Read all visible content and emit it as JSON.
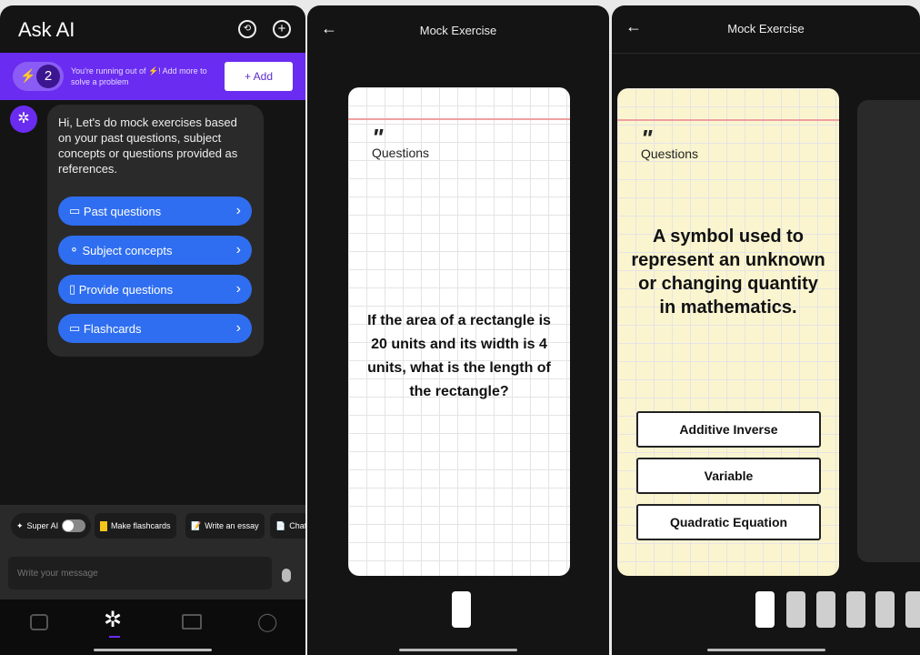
{
  "chat": {
    "title": "Ask AI",
    "icons": [
      "history-icon",
      "new-chat-icon"
    ],
    "banner": {
      "count": "2",
      "message": "You're running out of ⚡! Add more to solve a problem",
      "add_label": "+ Add",
      "color": "#6a2cf0"
    },
    "bot_message": "Hi, Let's do mock exercises based on your past questions, subject concepts or questions provided as references.",
    "options": [
      {
        "label": "Past questions",
        "icon": "inbox-icon"
      },
      {
        "label": "Subject concepts",
        "icon": "concepts-icon"
      },
      {
        "label": "Provide questions",
        "icon": "book-icon"
      },
      {
        "label": "Flashcards",
        "icon": "cards-icon"
      }
    ],
    "chips": {
      "super_ai": "Super AI",
      "make_flashcards": "Make flashcards",
      "write_essay": "Write an essay",
      "chat": "Chat"
    },
    "input_placeholder": "Write your message",
    "nav": [
      "camera-icon",
      "ai-icon",
      "book-icon",
      "profile-icon"
    ],
    "accent": "#2f6ef0"
  },
  "exercise1": {
    "title": "Mock Exercise",
    "label": "Questions",
    "question": "If the area of a rectangle is 20 units and its width is 4 units, what is the length of the rectangle?"
  },
  "exercise2": {
    "title": "Mock Exercise",
    "label": "Questions",
    "question": "A symbol used to represent an unknown or changing quantity in mathematics.",
    "answers": [
      "Additive Inverse",
      "Variable",
      "Quadratic Equation"
    ],
    "card_color": "#fbf5cf"
  }
}
